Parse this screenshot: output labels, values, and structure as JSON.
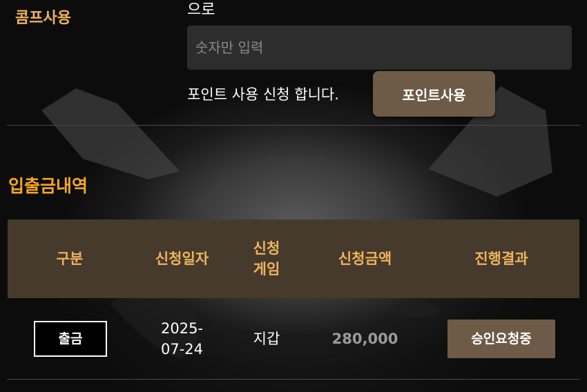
{
  "comp_section": {
    "label": "콤프사용",
    "top_text": "으로",
    "input_placeholder": "숫자만 입력",
    "input_value": "",
    "apply_text": "포인트 사용 신청 합니다.",
    "button_label": "포인트사용"
  },
  "history": {
    "title": "입출금내역",
    "columns": [
      "구분",
      "신청일자",
      "신청\n게임",
      "신청금액",
      "진행결과"
    ],
    "rows": [
      {
        "type": "출금",
        "date": "2025-\n07-24",
        "game": "지갑",
        "amount": "280,000",
        "status": "승인요청중"
      }
    ]
  },
  "colors": {
    "accent": "#f0b35c",
    "title_orange": "#f5a623",
    "header_bg": "#463a2d",
    "button_bg": "#6e5b47"
  }
}
